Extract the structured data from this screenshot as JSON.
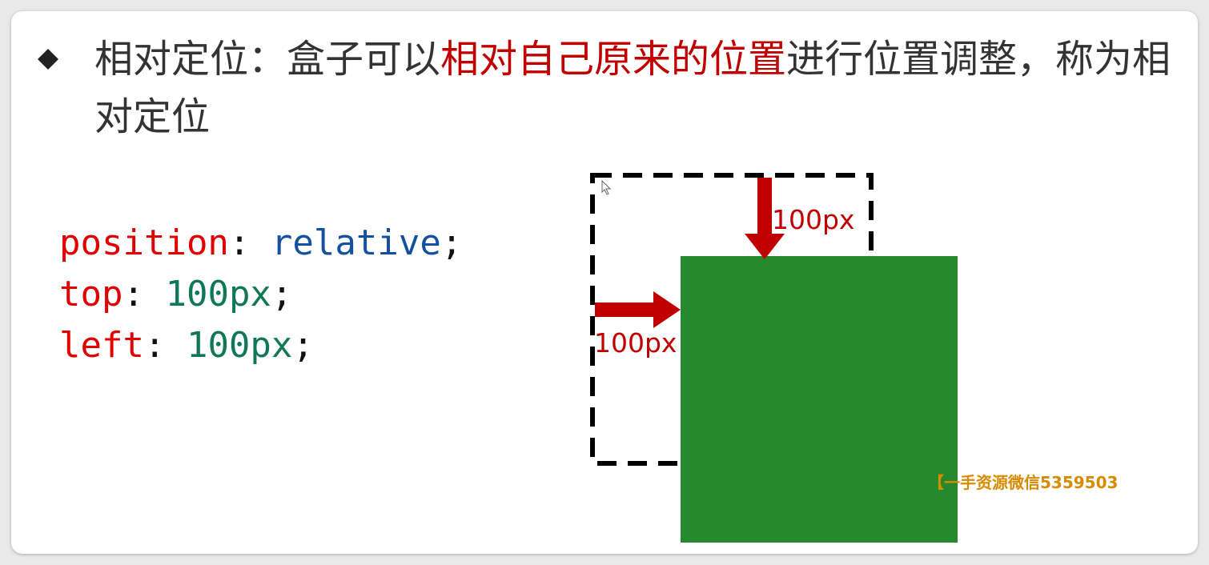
{
  "heading": {
    "prefix": "相对定位：盒子可以",
    "highlight": "相对自己原来的位置",
    "suffix": "进行位置调整，称为相对定位"
  },
  "code": {
    "line1": {
      "prop": "position",
      "colon": ": ",
      "value": "relative",
      "semi": ";"
    },
    "line2": {
      "prop": "top",
      "colon": ": ",
      "value": "100px",
      "semi": ";"
    },
    "line3": {
      "prop": "left",
      "colon": ": ",
      "value": "100px",
      "semi": ";"
    }
  },
  "diagram": {
    "top_offset_label": "100px",
    "left_offset_label": "100px",
    "box_color": "#258a2e",
    "arrow_color": "#c00000"
  },
  "watermark": "【一手资源微信5359503"
}
